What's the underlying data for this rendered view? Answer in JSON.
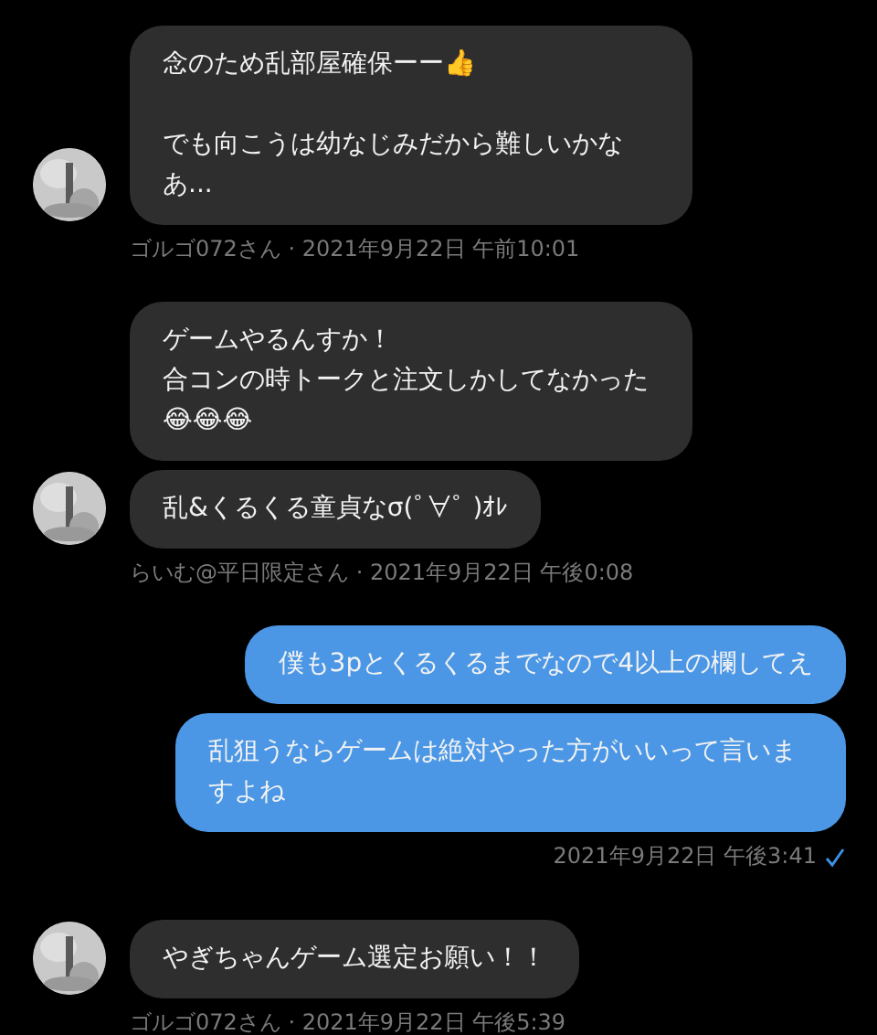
{
  "groups": [
    {
      "kind": "incoming",
      "avatar": {
        "kind": "picture"
      },
      "messages": [
        {
          "paragraphs": [
            [
              "念のため乱部屋確保ーー👍"
            ],
            [
              "でも向こうは幼なじみだから難しいかなあ..."
            ]
          ]
        }
      ],
      "meta": "ゴルゴ072さん · 2021年9月22日 午前10:01"
    },
    {
      "kind": "incoming",
      "avatar": {
        "kind": "picture"
      },
      "messages": [
        {
          "paragraphs": [
            [
              "ゲームやるんすか！",
              "合コンの時トークと注文しかしてなかった😂😂😂"
            ]
          ]
        },
        {
          "paragraphs": [
            [
              "乱&くるくる童貞なσ(ﾟ∀ﾟ )ｵﾚ"
            ]
          ]
        }
      ],
      "meta": "らいむ@平日限定さん · 2021年9月22日 午後0:08"
    },
    {
      "kind": "outgoing",
      "messages": [
        {
          "paragraphs": [
            [
              "僕も3pとくるくるまでなので4以上の欄してえ"
            ]
          ]
        },
        {
          "paragraphs": [
            [
              "乱狙うならゲームは絶対やった方がいいって言いますよね"
            ]
          ]
        }
      ],
      "meta": "2021年9月22日 午後3:41",
      "read": true
    },
    {
      "kind": "incoming",
      "avatar": {
        "kind": "picture"
      },
      "messages": [
        {
          "paragraphs": [
            [
              "やぎちゃんゲーム選定お願い！！"
            ]
          ]
        }
      ],
      "meta": "ゴルゴ072さん · 2021年9月22日 午後5:39"
    }
  ]
}
